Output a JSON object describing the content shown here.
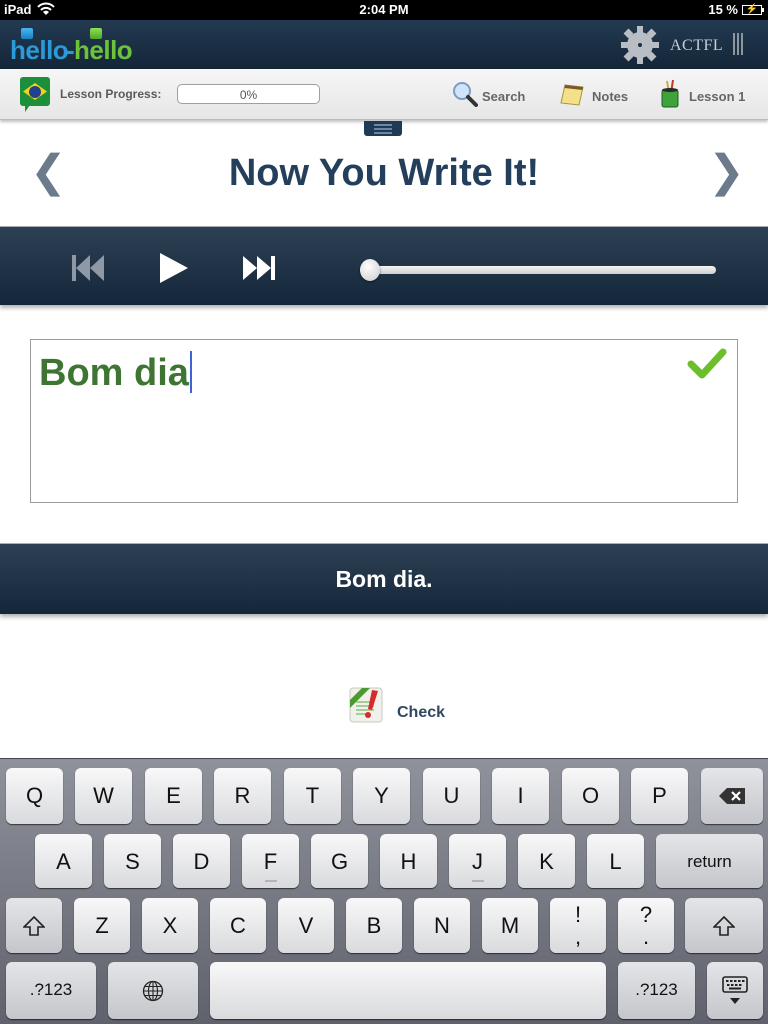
{
  "status_bar": {
    "carrier": "iPad",
    "time": "2:04 PM",
    "battery": "15 %"
  },
  "app_header": {
    "logo_left": "hello",
    "logo_dash": "-",
    "logo_right": "hello",
    "partner_label": "ACTFL"
  },
  "toolbar": {
    "progress_label": "Lesson Progress:",
    "progress_value": 0,
    "progress_text": "0%",
    "search_label": "Search",
    "notes_label": "Notes",
    "lesson_label": "Lesson 1"
  },
  "page": {
    "title": "Now You Write It!",
    "prev_glyph": "❮",
    "next_glyph": "❯"
  },
  "player": {
    "position_fraction": 0.0
  },
  "answer": {
    "typed_text": "Bom dia",
    "correct": true,
    "accent_color": "#3f7533",
    "expected_text": "Bom dia."
  },
  "check_button": {
    "label": "Check"
  },
  "keyboard": {
    "row1": [
      "Q",
      "W",
      "E",
      "R",
      "T",
      "Y",
      "U",
      "I",
      "O",
      "P"
    ],
    "row2": [
      "A",
      "S",
      "D",
      "F",
      "G",
      "H",
      "J",
      "K",
      "L"
    ],
    "row3": [
      "Z",
      "X",
      "C",
      "V",
      "B",
      "N",
      "M"
    ],
    "return_label": "return",
    "exclaim_top": "!",
    "exclaim_bottom": ",",
    "question_top": "?",
    "question_bottom": ".",
    "numbers_label": ".?123"
  }
}
